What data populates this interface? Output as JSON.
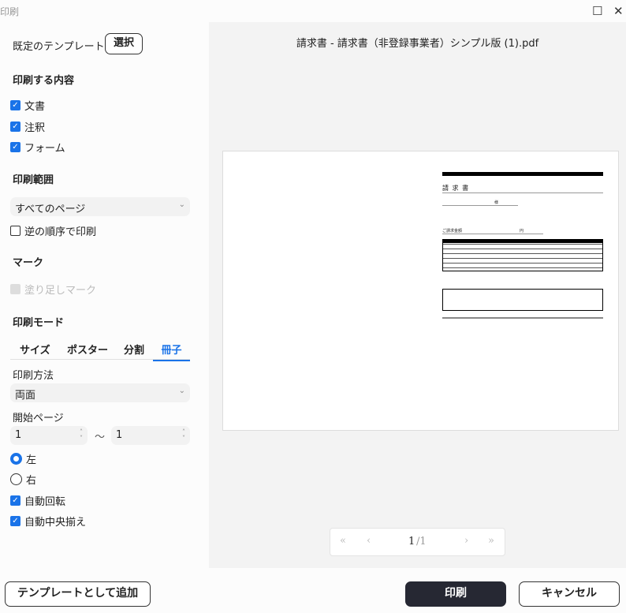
{
  "window": {
    "title": "印刷",
    "maximize_icon": "square-icon",
    "close_icon": "x-icon"
  },
  "template": {
    "label": "既定のテンプレート",
    "select_button": "選択"
  },
  "content": {
    "heading": "印刷する内容",
    "items": [
      {
        "label": "文書",
        "checked": true
      },
      {
        "label": "注釈",
        "checked": true
      },
      {
        "label": "フォーム",
        "checked": true
      }
    ]
  },
  "range": {
    "heading": "印刷範囲",
    "selected": "すべてのページ",
    "reverse_label": "逆の順序で印刷",
    "reverse_checked": false
  },
  "marks": {
    "heading": "マーク",
    "bleed_label": "塗り足しマーク",
    "bleed_enabled": false
  },
  "mode": {
    "heading": "印刷モード",
    "tabs": [
      "サイズ",
      "ポスター",
      "分割",
      "冊子"
    ],
    "active_tab": "冊子",
    "method_label": "印刷方法",
    "method_value": "両面",
    "start_label": "開始ページ",
    "from": "1",
    "tilde": "〜",
    "to": "1",
    "binding": [
      {
        "label": "左",
        "selected": true
      },
      {
        "label": "右",
        "selected": false
      }
    ],
    "auto_rotate": {
      "label": "自動回転",
      "checked": true
    },
    "auto_center": {
      "label": "自動中央揃え",
      "checked": true
    }
  },
  "preview": {
    "filename": "請求書 - 請求書（非登録事業者）シンプル版 (1).pdf",
    "invoice": {
      "title": "請 求 書",
      "honorific": "様",
      "amount_label": "ご請求金額",
      "yen": "円"
    },
    "pager": {
      "current": "1",
      "total": "/1"
    }
  },
  "footer": {
    "add_template": "テンプレートとして追加",
    "print": "印刷",
    "cancel": "キャンセル"
  },
  "colors": {
    "accent": "#1a73e8",
    "print_button": "#262833"
  }
}
